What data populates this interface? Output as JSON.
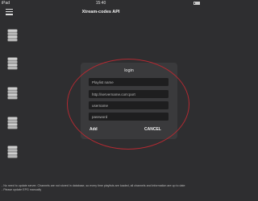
{
  "status_bar": {
    "device": "iPad",
    "time": "15:40"
  },
  "nav": {
    "title": "Xtream-codes API",
    "menu_icon": "hamburger-icon"
  },
  "server_list": {
    "icon": "server-stack-icon",
    "count": 5
  },
  "login": {
    "title": "login",
    "playlist_placeholder": "Playlist name",
    "url_placeholder": "http://servername.com:port",
    "username_placeholder": "username",
    "password_placeholder": "password",
    "add_label": "Add",
    "cancel_label": "CANCEL"
  },
  "colors": {
    "background": "#2e2e30",
    "dialog": "#3a3a3c",
    "field": "#1e1e1f",
    "highlight_circle": "#b12a32"
  },
  "footer": {
    "line1": "- No need to update server. Channels are not stored in database, so every time playlists are loaded, all channels and information are up to date",
    "line2": "- Please update EPG manually"
  }
}
